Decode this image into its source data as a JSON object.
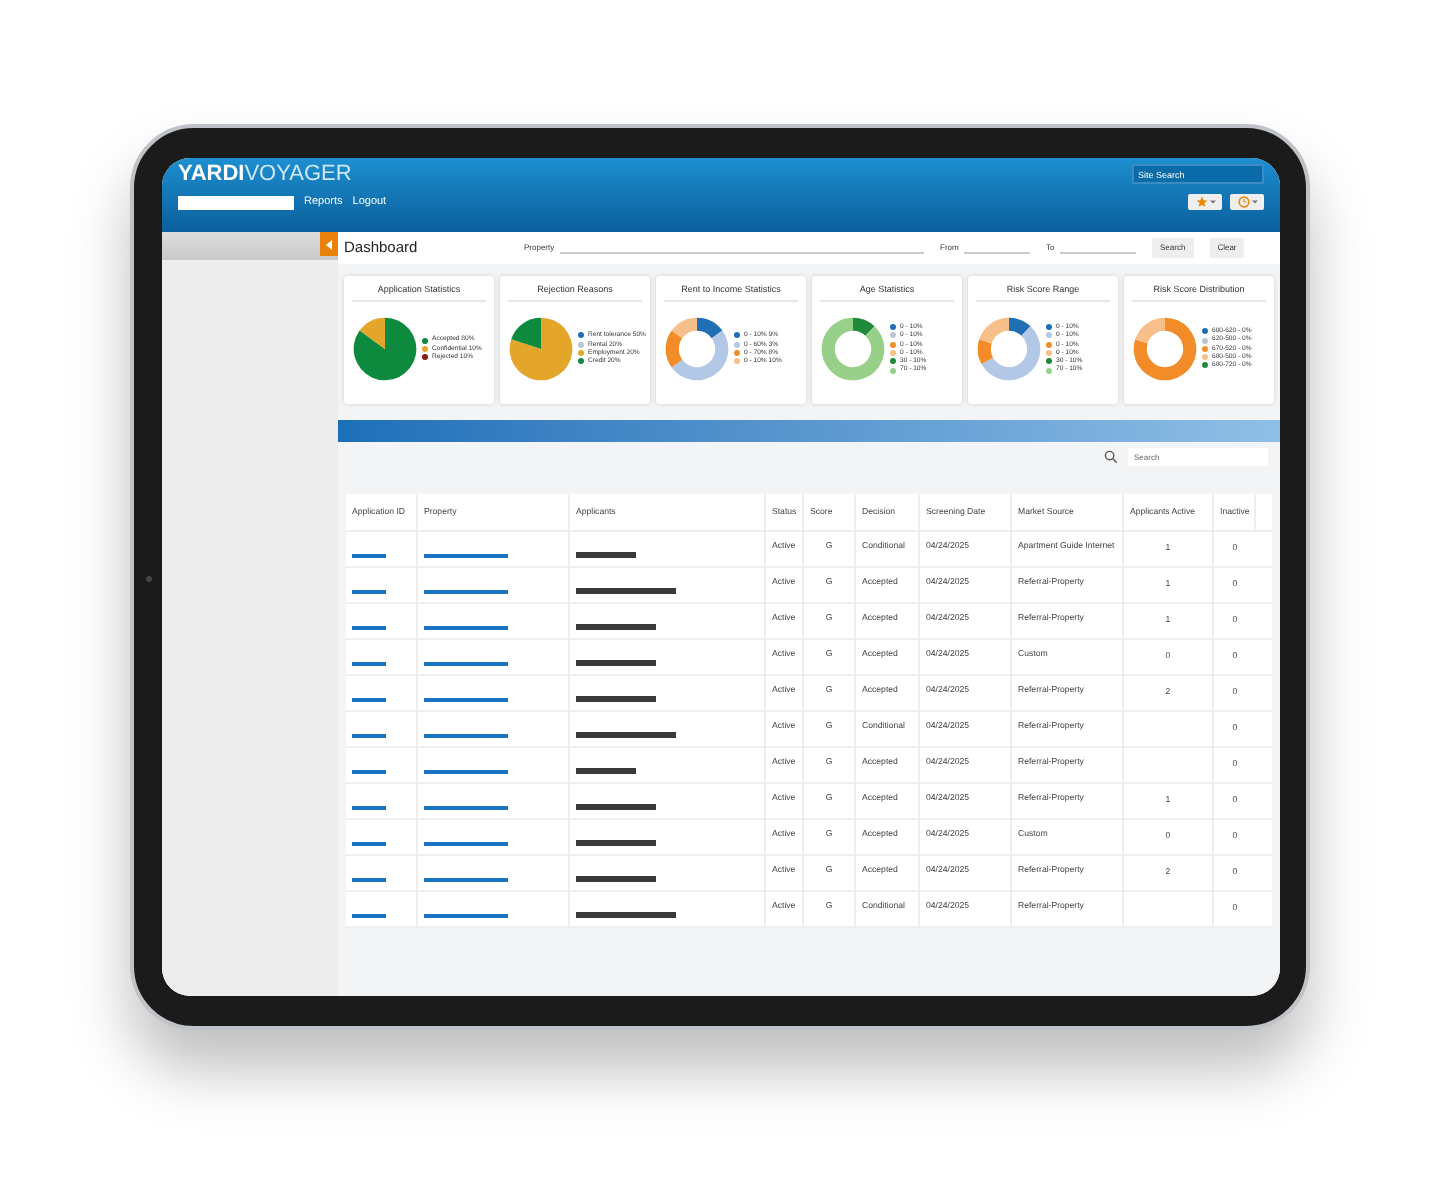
{
  "header": {
    "logo_bold": "YARDI",
    "logo_light": "VOYAGER",
    "nav": [
      "Reports",
      "Logout"
    ],
    "site_search": {
      "placeholder": "Site Search"
    }
  },
  "dashboard": {
    "title": "Dashboard",
    "filters": [
      {
        "label": "Property"
      },
      {
        "label": "From"
      },
      {
        "label": "To"
      }
    ],
    "buttons": [
      "Search",
      "Clear"
    ]
  },
  "charts": [
    {
      "chart_data": {
        "type": "pie",
        "title": "Application Statistics",
        "legend": "right",
        "categories": [
          "Accepted 80%",
          "Confidential 10%",
          "Rejected 10%"
        ],
        "values": [
          85,
          15,
          0
        ],
        "colors": [
          "#0e8a3e",
          "#e3a52a",
          "#8b1a1a"
        ]
      }
    },
    {
      "chart_data": {
        "type": "pie",
        "title": "Rejection Reasons",
        "legend": "right",
        "categories": [
          "Rent tolerance 50%",
          "Rental 20%",
          "Employment 20%",
          "Credit 20%"
        ],
        "values": [
          0,
          0,
          80,
          20
        ],
        "colors": [
          "#1f6fb5",
          "#b9c6d6",
          "#e3a52a",
          "#0e8a3e"
        ]
      }
    },
    {
      "chart_data": {
        "type": "donut",
        "title": "Rent to Income Statistics",
        "legend": "right",
        "categories": [
          "0 - 10%  9%",
          "0 - 60%  3%",
          "0 - 70%  8%",
          "0 - 10%  10%"
        ],
        "values": [
          15,
          50,
          20,
          15
        ],
        "colors": [
          "#1f6fb5",
          "#b3c7e6",
          "#f28c28",
          "#f7c08a"
        ]
      }
    },
    {
      "chart_data": {
        "type": "donut",
        "title": "Age Statistics",
        "legend": "right",
        "categories": [
          "0 - 10%",
          "0 - 10%",
          "0 - 10%",
          "0 - 10%",
          "30 - 10%",
          "70 - 10%"
        ],
        "values": [
          0,
          0,
          0,
          0,
          12,
          88
        ],
        "colors": [
          "#1f6fb5",
          "#b9c6d6",
          "#f28c28",
          "#f7c08a",
          "#1e8a3a",
          "#98d08a"
        ]
      }
    },
    {
      "chart_data": {
        "type": "donut",
        "title": "Risk Score Range",
        "legend": "right",
        "categories": [
          "0 - 10%",
          "0 - 10%",
          "0 - 10%",
          "0 - 10%",
          "30 - 10%",
          "70 - 10%"
        ],
        "values": [
          12,
          55,
          13,
          20,
          0,
          0
        ],
        "colors": [
          "#1f6fb5",
          "#b3c7e6",
          "#f28c28",
          "#f7c08a",
          "#1e8a3a",
          "#98d08a"
        ]
      }
    },
    {
      "chart_data": {
        "type": "donut",
        "title": "Risk Score Distribution",
        "legend": "right",
        "categories": [
          "600-620 - 0%",
          "620-500 - 0%",
          "670-520 - 0%",
          "680-500 - 0%",
          "680-720 - 0%"
        ],
        "values": [
          0,
          0,
          80,
          20,
          0
        ],
        "colors": [
          "#1f6fb5",
          "#b9c6d6",
          "#f28c28",
          "#f7c08a",
          "#1e8a3a"
        ]
      }
    }
  ],
  "search": {
    "placeholder": "Search"
  },
  "table": {
    "columns": [
      "Application ID",
      "Property",
      "Applicants",
      "Status",
      "Score",
      "Decision",
      "Screening Date",
      "Market Source",
      "Applicants Active",
      "Inactive"
    ],
    "rows": [
      {
        "kind": "short",
        "status": "Active",
        "score": "G",
        "decision": "Conditional",
        "date": "04/24/2025",
        "source": "Apartment Guide Internet",
        "active": "1",
        "inactive": "0"
      },
      {
        "kind": "long",
        "status": "Active",
        "score": "G",
        "decision": "Accepted",
        "date": "04/24/2025",
        "source": "Referral-Property",
        "active": "1",
        "inactive": "0"
      },
      {
        "kind": "medium",
        "status": "Active",
        "score": "G",
        "decision": "Accepted",
        "date": "04/24/2025",
        "source": "Referral-Property",
        "active": "1",
        "inactive": "0"
      },
      {
        "kind": "medium",
        "status": "Active",
        "score": "G",
        "decision": "Accepted",
        "date": "04/24/2025",
        "source": "Custom",
        "active": "0",
        "inactive": "0"
      },
      {
        "kind": "medium",
        "status": "Active",
        "score": "G",
        "decision": "Accepted",
        "date": "04/24/2025",
        "source": "Referral-Property",
        "active": "2",
        "inactive": "0"
      },
      {
        "kind": "long",
        "status": "Active",
        "score": "G",
        "decision": "Conditional",
        "date": "04/24/2025",
        "source": "Referral-Property",
        "inactive": "0"
      },
      {
        "kind": "short",
        "status": "Active",
        "score": "G",
        "decision": "Accepted",
        "date": "04/24/2025",
        "source": "Referral-Property",
        "inactive": "0"
      },
      {
        "kind": "medium",
        "status": "Active",
        "score": "G",
        "decision": "Accepted",
        "date": "04/24/2025",
        "source": "Referral-Property",
        "active": "1",
        "inactive": "0"
      },
      {
        "kind": "medium",
        "status": "Active",
        "score": "G",
        "decision": "Accepted",
        "date": "04/24/2025",
        "source": "Custom",
        "active": "0",
        "inactive": "0"
      },
      {
        "kind": "medium",
        "status": "Active",
        "score": "G",
        "decision": "Accepted",
        "date": "04/24/2025",
        "source": "Referral-Property",
        "active": "2",
        "inactive": "0"
      },
      {
        "kind": "long",
        "status": "Active",
        "score": "G",
        "decision": "Conditional",
        "date": "04/24/2025",
        "source": "Referral-Property",
        "inactive": "0"
      }
    ]
  }
}
